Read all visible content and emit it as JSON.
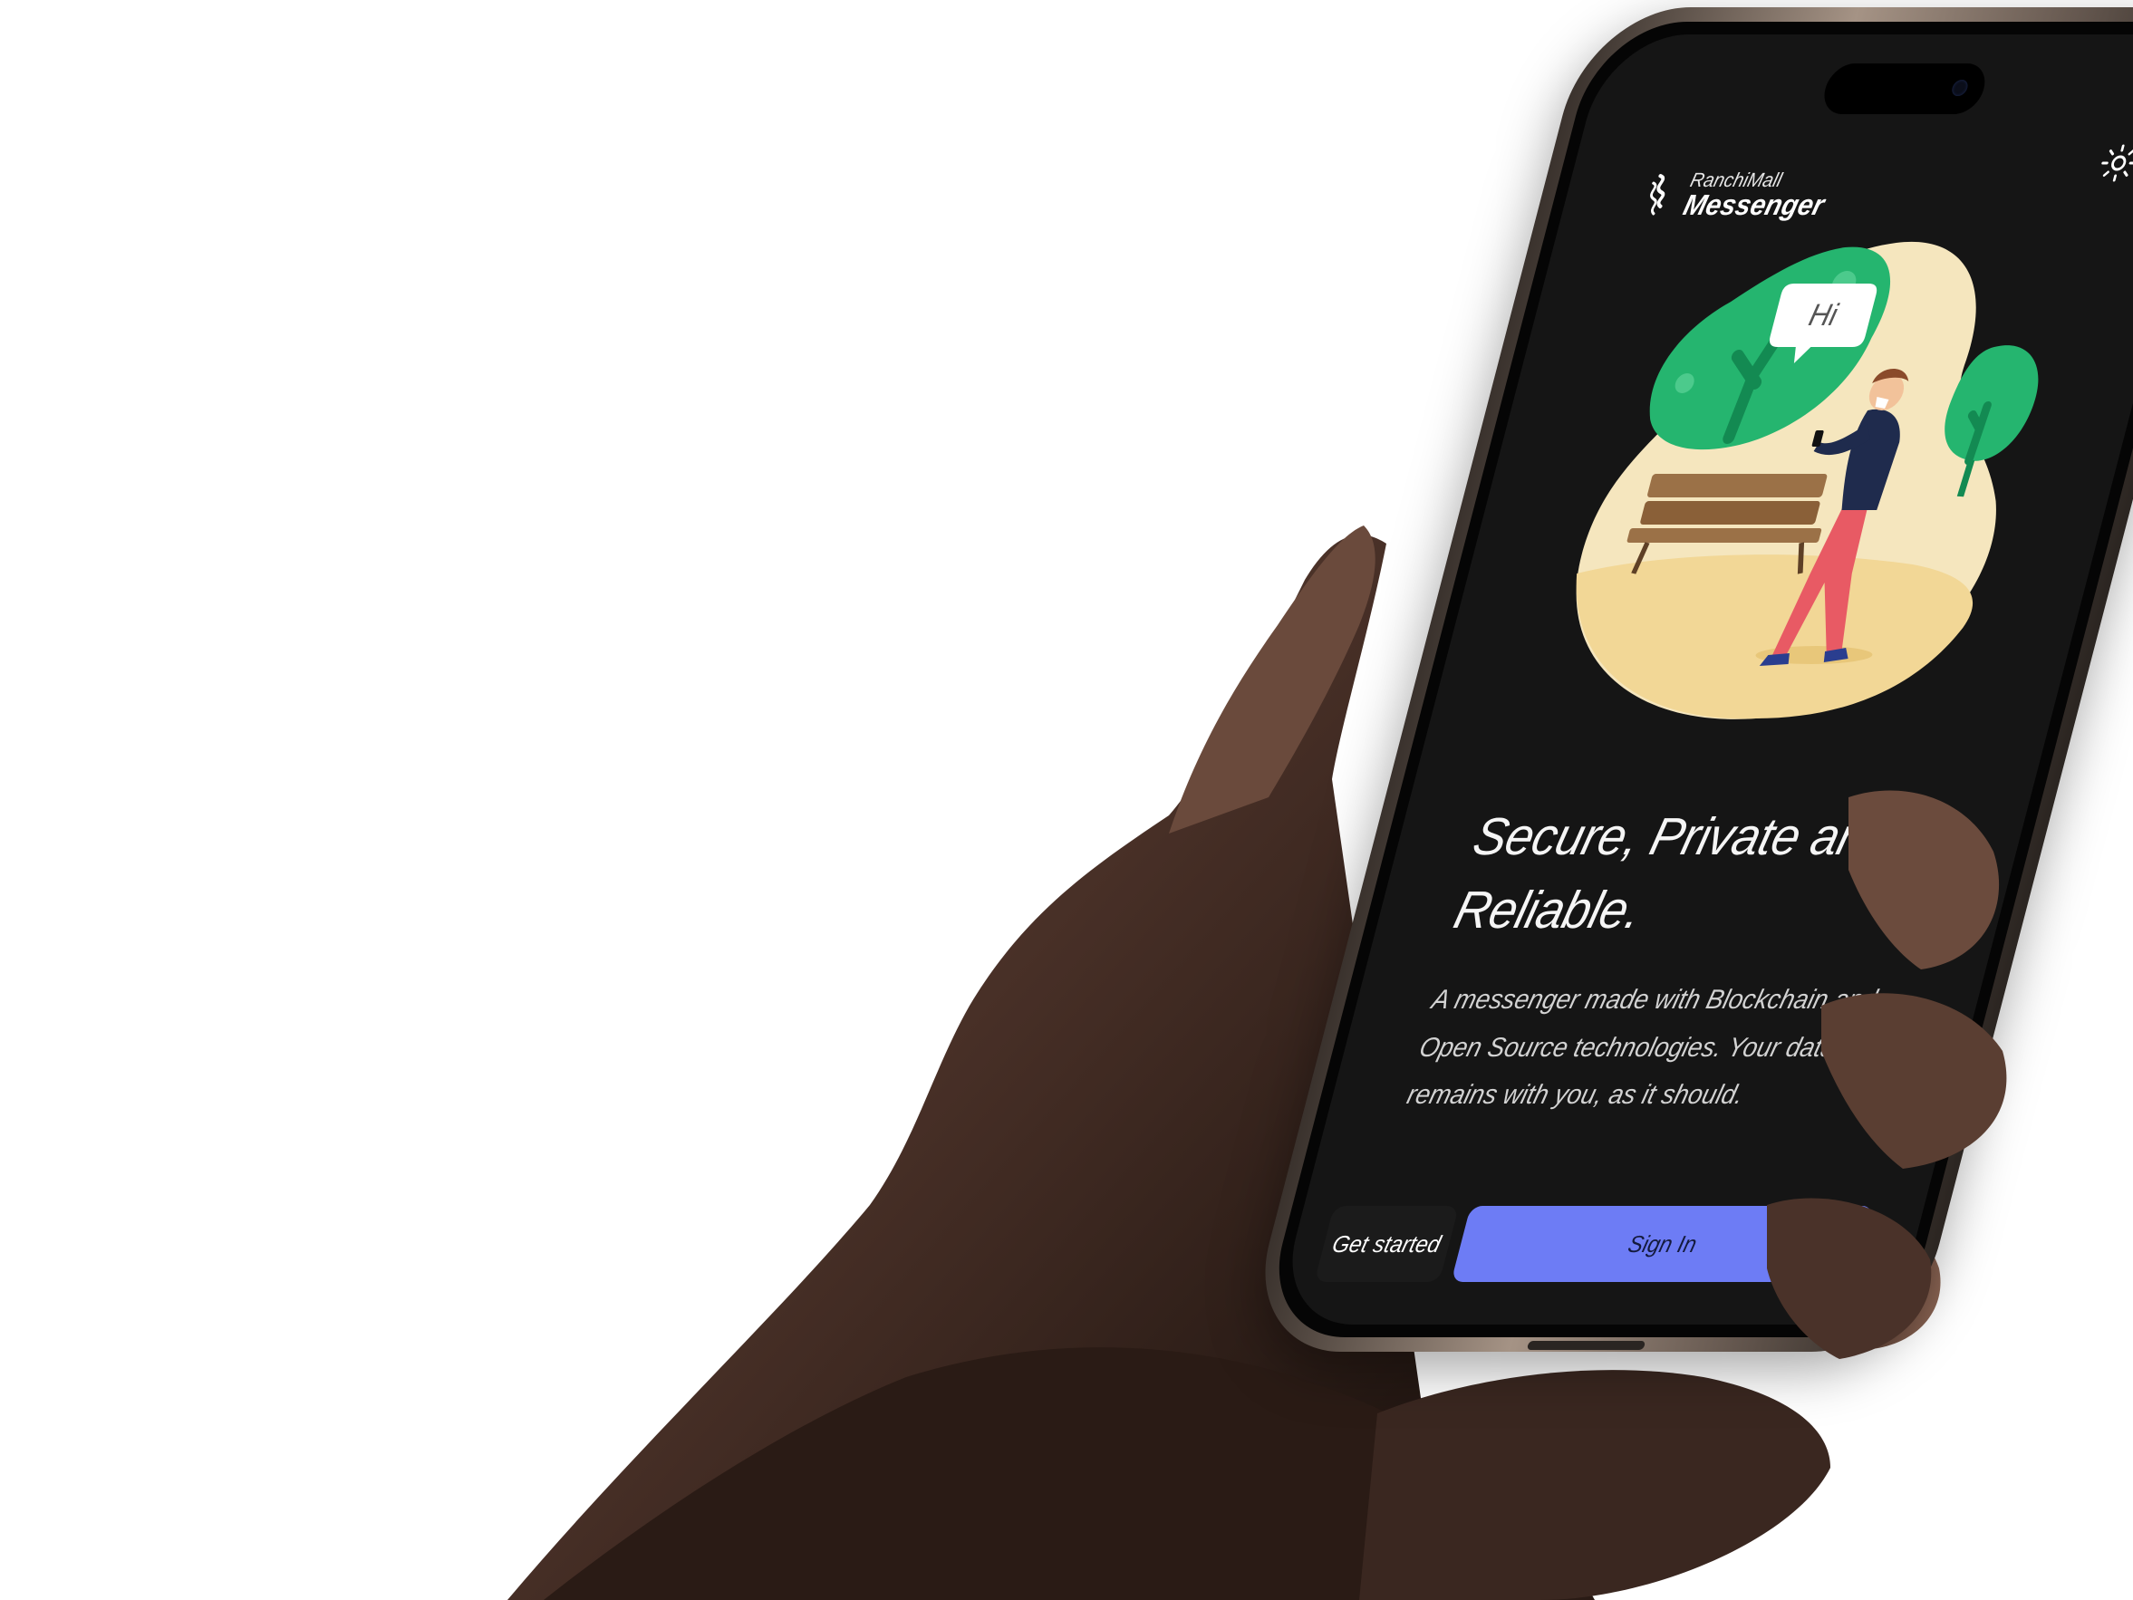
{
  "app": {
    "brand_small": "RanchiMall",
    "brand_name": "Messenger",
    "theme_toggle_icon": "sun-icon",
    "accent_color": "#6d7cf5",
    "background_color": "#151515"
  },
  "illustration": {
    "bubble_text": "Hi",
    "icon": "person-walking-with-phone-illustration"
  },
  "hero": {
    "headline_line1": "Secure, Private and",
    "headline_line2": "Reliable.",
    "subtitle_line1": "A messenger made with Blockchain and",
    "subtitle_line2": "Open Source technologies. Your data",
    "subtitle_line3": "remains with you, as it should."
  },
  "actions": {
    "get_started_label": "Get started",
    "sign_in_label": "Sign In"
  }
}
